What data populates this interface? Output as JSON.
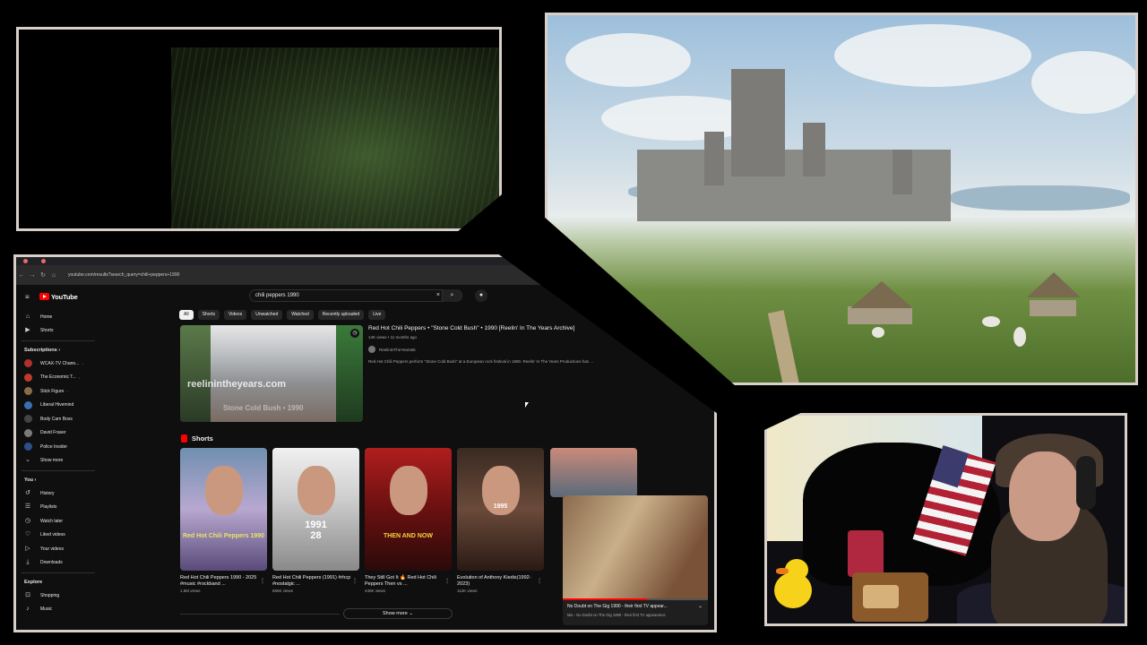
{
  "browser": {
    "url": "youtube.com/results?search_query=chili+peppers+1990"
  },
  "youtube": {
    "logo_text": "YouTube",
    "search_value": "chili peppers 1990",
    "clear_icon": "×",
    "search_icon": "⌕",
    "mic_icon": "🎙",
    "menu_icon": "≡",
    "sidebar": {
      "main": [
        {
          "label": "Home",
          "icon": "⌂"
        },
        {
          "label": "Shorts",
          "icon": "▶"
        }
      ],
      "subscriptions_header": "Subscriptions  ›",
      "subscriptions": [
        {
          "label": "WCAX-TV Chann...",
          "color": "#b03030"
        },
        {
          "label": "The Economic T...",
          "color": "#c0392b"
        },
        {
          "label": "Stick Figure",
          "color": "#8a6a4a"
        },
        {
          "label": "Liberal Hivemind",
          "color": "#3a6fb0"
        },
        {
          "label": "Body Cam Boss",
          "color": "#444444"
        },
        {
          "label": "David Fraser",
          "color": "#7a7a7a"
        },
        {
          "label": "Police Insider",
          "color": "#2d4f8a"
        }
      ],
      "show_more": "Show more",
      "you_header": "You  ›",
      "you_items": [
        {
          "label": "History",
          "icon": "↺"
        },
        {
          "label": "Playlists",
          "icon": "☰"
        },
        {
          "label": "Watch later",
          "icon": "◷"
        },
        {
          "label": "Liked videos",
          "icon": "♡"
        },
        {
          "label": "Your videos",
          "icon": "▷"
        },
        {
          "label": "Downloads",
          "icon": "⤓"
        }
      ],
      "explore_header": "Explore",
      "explore_items": [
        {
          "label": "Shopping",
          "icon": "⊡"
        },
        {
          "label": "Music",
          "icon": "♪"
        }
      ]
    },
    "chips": [
      "All",
      "Shorts",
      "Videos",
      "Unwatched",
      "Watched",
      "Recently uploaded",
      "Live"
    ],
    "result": {
      "title": "Red Hot Chili Peppers • \"Stone Cold Bush\" • 1990 [Reelin' In The Years Archive]",
      "meta": "14K views • 11 months ago",
      "channel": "ReelinInTheYears66",
      "description": "Red Hot Chili Peppers perform \"Stone Cold Bush\" at a European rock festival in 1990. Reelin' In The Years Productions has ...",
      "watermark": "reelinintheyears.com",
      "watermark2": "Stone Cold Bush • 1990"
    },
    "shorts_header": "Shorts",
    "shorts": [
      {
        "caption": "Red Hot Chili Peppers 1990 - 2025 #music #rockband ...",
        "views": "1.5M views",
        "overlay": "Red Hot Chili Peppers 1990"
      },
      {
        "caption": "Red Hot Chili Peppers (1991) #rhcp #nostalgic ...",
        "views": "655K views",
        "overlay": "1991\n28"
      },
      {
        "caption": "They Still Got It 🔥 Red Hot Chili Peppers Then vs ...",
        "views": "440K views",
        "overlay": "THEN AND NOW"
      },
      {
        "caption": "Evolution of Anthony Kiedis(1992-2023)",
        "views": "112K views",
        "overlay": "1995"
      }
    ],
    "show_more_btn": "Show more  ⌄",
    "miniplayer": {
      "title": "No Doubt on The Gig 1990 - their first TV appear...",
      "subtitle": "Mix - No Doubt on The Gig 1990 - their first TV appearance",
      "progress": 0.58
    }
  }
}
